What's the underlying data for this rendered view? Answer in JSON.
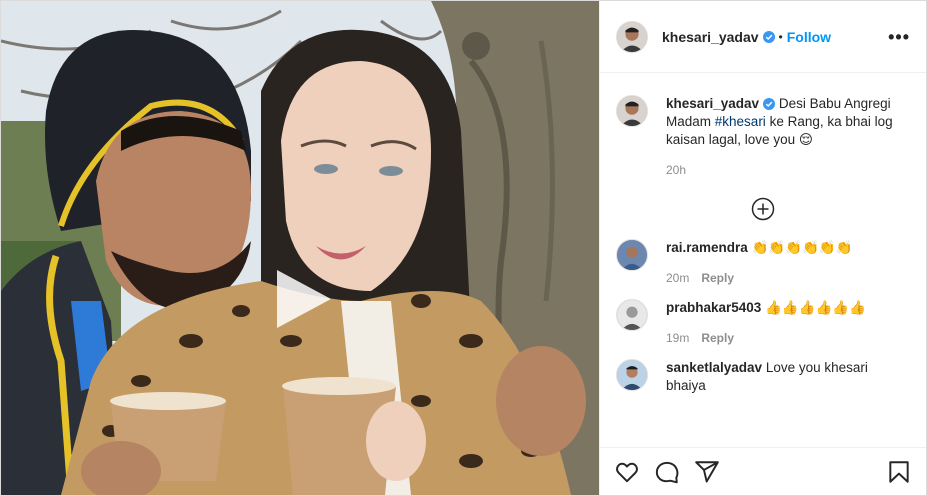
{
  "post": {
    "username": "khesari_yadav",
    "separator": "•",
    "follow_label": "Follow",
    "more_label": "•••"
  },
  "caption": {
    "username": "khesari_yadav",
    "text_before": " Desi Babu Angregi Madam ",
    "hashtag": "#khesari",
    "text_after": " ke Rang, ka bhai log kaisan lagal, love you 😌",
    "time": "20h"
  },
  "comments": [
    {
      "username": "rai.ramendra",
      "text": " 👏👏👏👏👏👏",
      "time": "20m",
      "reply_label": "Reply"
    },
    {
      "username": "prabhakar5403",
      "text": " 👍👍👍👍👍👍",
      "time": "19m",
      "reply_label": "Reply"
    },
    {
      "username": "sanketlalyadav",
      "text": " Love you khesari bhaiya",
      "time": "",
      "reply_label": ""
    }
  ],
  "icons": {
    "play": "play-icon",
    "verified": "verified-badge-icon",
    "load_more": "plus-circle-icon",
    "like": "heart-icon",
    "comment": "comment-bubble-icon",
    "share": "paper-plane-icon",
    "save": "bookmark-icon"
  },
  "colors": {
    "accent": "#0095f6",
    "hashtag": "#00376b",
    "secondary_text": "#8e8e8e",
    "border": "#dbdbdb"
  }
}
